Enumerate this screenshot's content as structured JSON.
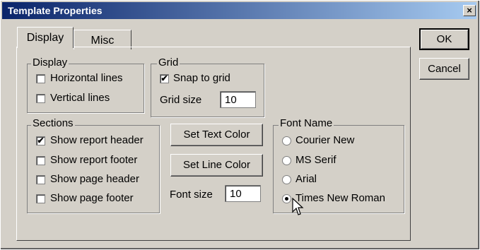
{
  "window": {
    "title": "Template Properties",
    "close_label": "×"
  },
  "tabs": [
    {
      "label": "Display"
    },
    {
      "label": "Misc"
    }
  ],
  "display_group": {
    "legend": "Display",
    "options": [
      {
        "label": "Horizontal lines",
        "checked": false
      },
      {
        "label": "Vertical lines",
        "checked": false
      }
    ]
  },
  "grid_group": {
    "legend": "Grid",
    "snap_label": "Snap to grid",
    "snap_checked": true,
    "size_label": "Grid size",
    "size_value": "10"
  },
  "sections_group": {
    "legend": "Sections",
    "options": [
      {
        "label": "Show report header",
        "checked": true
      },
      {
        "label": "Show report footer",
        "checked": false
      },
      {
        "label": "Show page header",
        "checked": false
      },
      {
        "label": "Show page footer",
        "checked": false
      }
    ]
  },
  "buttons": {
    "set_text_color": "Set Text Color",
    "set_line_color": "Set Line Color",
    "ok": "OK",
    "cancel": "Cancel"
  },
  "font_size": {
    "label": "Font size",
    "value": "10"
  },
  "font_name_group": {
    "legend": "Font Name",
    "options": [
      {
        "label": "Courier New",
        "selected": false
      },
      {
        "label": "MS Serif",
        "selected": false
      },
      {
        "label": "Arial",
        "selected": false
      },
      {
        "label": "Times New Roman",
        "selected": true
      }
    ]
  },
  "check_glyph": "✔"
}
